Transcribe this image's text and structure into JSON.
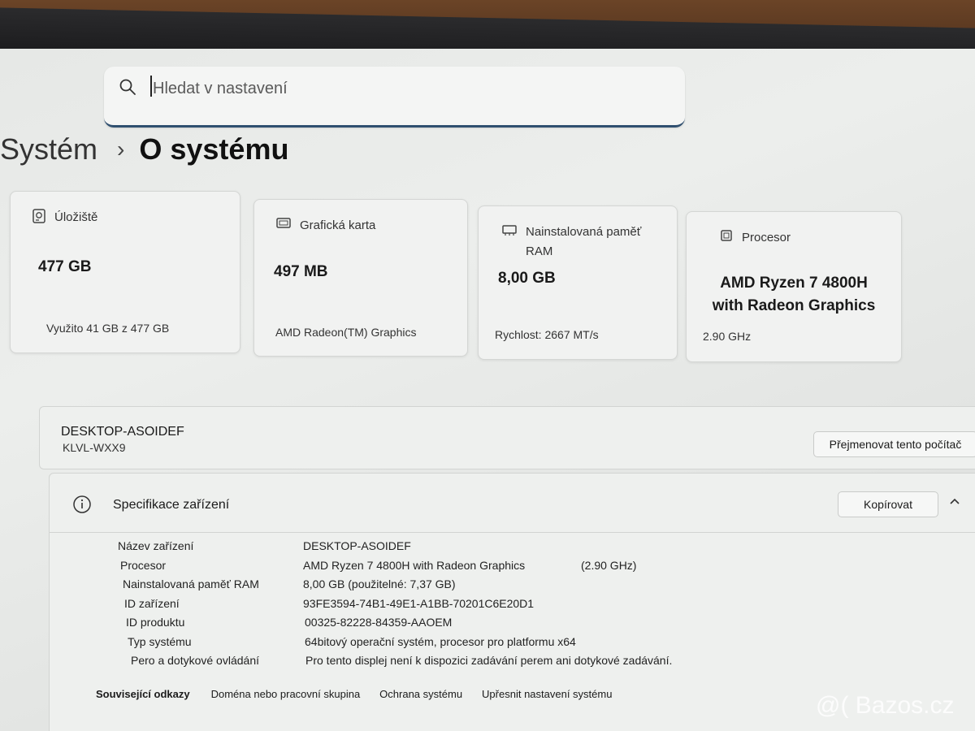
{
  "search": {
    "placeholder": "Hledat v nastavení"
  },
  "breadcrumb": {
    "parent": "Systém",
    "current": "O systému"
  },
  "cards": {
    "storage": {
      "title": "Úložiště",
      "value": "477 GB",
      "detail": "Využito 41 GB z 477 GB"
    },
    "gpu": {
      "title": "Grafická karta",
      "value": "497 MB",
      "detail": "AMD Radeon(TM) Graphics"
    },
    "ram": {
      "title_line1": "Nainstalovaná paměť",
      "title_line2": "RAM",
      "value": "8,00 GB",
      "detail": "Rychlost: 2667 MT/s"
    },
    "cpu": {
      "title": "Procesor",
      "value_line1": "AMD Ryzen 7 4800H",
      "value_line2": "with Radeon Graphics",
      "detail": "2.90 GHz"
    }
  },
  "device": {
    "name": "DESKTOP-ASOIDEF",
    "model": "KLVL-WXX9",
    "rename_button": "Přejmenovat tento počítač"
  },
  "specs": {
    "title": "Specifikace zařízení",
    "copy_button": "Kopírovat",
    "rows": [
      {
        "key": "Název zařízení",
        "value": "DESKTOP-ASOIDEF",
        "extra": ""
      },
      {
        "key": "Procesor",
        "value": "AMD Ryzen 7 4800H with Radeon Graphics",
        "extra": "(2.90 GHz)"
      },
      {
        "key": "Nainstalovaná paměť RAM",
        "value": "8,00 GB (použitelné: 7,37 GB)",
        "extra": ""
      },
      {
        "key": "ID zařízení",
        "value": "93FE3594-74B1-49E1-A1BB-70201C6E20D1",
        "extra": ""
      },
      {
        "key": "ID produktu",
        "value": "00325-82228-84359-AAOEM",
        "extra": ""
      },
      {
        "key": "Typ systému",
        "value": "64bitový operační systém, procesor pro platformu x64",
        "extra": ""
      },
      {
        "key": "Pero a dotykové ovládání",
        "value": "Pro tento displej není k dispozici zadávání perem ani dotykové zadávání.",
        "extra": ""
      }
    ]
  },
  "related": {
    "label": "Související odkazy",
    "links": [
      "Doména nebo pracovní skupina",
      "Ochrana systému",
      "Upřesnit nastavení systému"
    ]
  },
  "watermark": "@( Bazos.cz",
  "colors": {
    "accent_underline": "#2f4f6f",
    "card_bg": "#f1f2f1",
    "screen_bg": "#e6e8e6"
  }
}
